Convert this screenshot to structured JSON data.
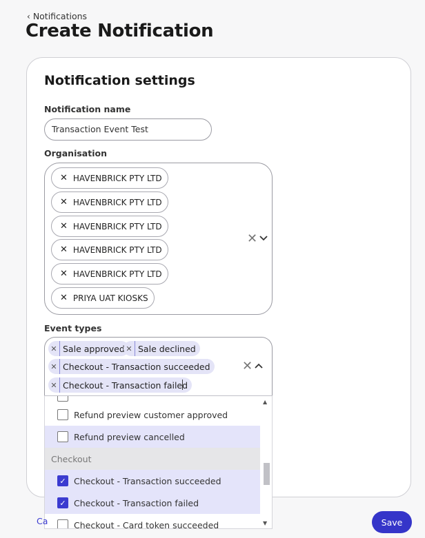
{
  "breadcrumb": {
    "back_label": "Notifications"
  },
  "page_title": "Create Notification",
  "card": {
    "section_title": "Notification settings"
  },
  "notification_name": {
    "label": "Notification name",
    "value": "Transaction Event Test"
  },
  "organisation": {
    "label": "Organisation",
    "chips": [
      "HAVENBRICK PTY LTD",
      "HAVENBRICK PTY LTD",
      "HAVENBRICK PTY LTD",
      "HAVENBRICK PTY LTD",
      "HAVENBRICK PTY LTD",
      "PRIYA UAT KIOSKS"
    ]
  },
  "event_types": {
    "label": "Event types",
    "selected": [
      "Sale approved",
      "Sale declined",
      "Checkout - Transaction succeeded",
      "Checkout - Transaction failed"
    ],
    "options": {
      "refund_preview_customer_approved": {
        "label": "Refund preview customer approved",
        "checked": false
      },
      "refund_preview_cancelled": {
        "label": "Refund preview cancelled",
        "checked": false
      },
      "group_checkout": "Checkout",
      "checkout_transaction_succeeded": {
        "label": "Checkout - Transaction succeeded",
        "checked": true
      },
      "checkout_transaction_failed": {
        "label": "Checkout - Transaction failed",
        "checked": true
      },
      "checkout_card_token_succeeded": {
        "label": "Checkout - Card token succeeded",
        "checked": false
      }
    }
  },
  "footer": {
    "cancel_label": "Ca",
    "save_label": "Save"
  },
  "icons": {
    "remove": "×",
    "clear": "✕",
    "chevron_down": "⌄",
    "chevron_up": "⌃",
    "check": "✓",
    "back": "‹"
  },
  "colors": {
    "accent": "#3535c9",
    "highlight": "#e4e4fa",
    "tag_bg": "#e4e4f7"
  }
}
